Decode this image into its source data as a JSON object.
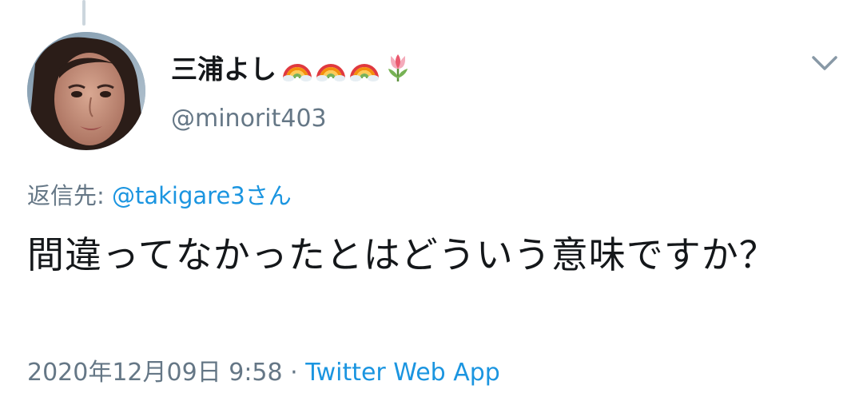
{
  "tweet": {
    "author": {
      "display_name": "三浦よし",
      "name_emojis": [
        "rainbow-icon",
        "rainbow-icon",
        "rainbow-icon",
        "tulip-icon"
      ],
      "handle": "@minorit403"
    },
    "reply_to": {
      "prefix": "返信先: ",
      "mention": "@takigare3さん"
    },
    "text": "間違ってなかったとはどういう意味ですか？",
    "timestamp": "2020年12月09日 9:58",
    "separator": " · ",
    "source": "Twitter Web App"
  },
  "icons": {
    "more_menu": "chevron-down-icon"
  },
  "colors": {
    "primary_text": "#14171a",
    "secondary_text": "#657786",
    "link": "#1b95e0",
    "thread_line": "#ccd6dd",
    "chevron": "#8899a6"
  }
}
